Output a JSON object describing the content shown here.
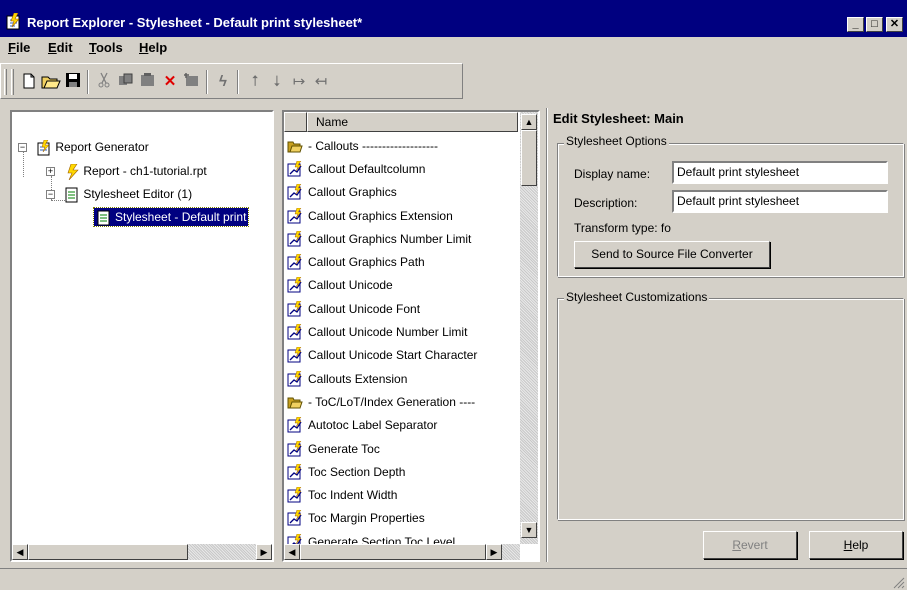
{
  "window": {
    "title": "Report Explorer - Stylesheet - Default print stylesheet*",
    "caption_buttons": [
      "minimize",
      "maximize",
      "close"
    ]
  },
  "menu": [
    {
      "key": "F",
      "rest": "ile"
    },
    {
      "key": "E",
      "rest": "dit"
    },
    {
      "key": "T",
      "rest": "ools"
    },
    {
      "key": "H",
      "rest": "elp"
    }
  ],
  "toolbar": {
    "icons": [
      "new-icon",
      "open-icon",
      "save-icon",
      "cut-icon",
      "copy-icon",
      "paste-icon",
      "delete-icon",
      "paste-special-icon",
      "run-icon",
      "move-up-icon",
      "move-down-icon",
      "demote-icon",
      "promote-icon"
    ]
  },
  "tree": {
    "items": [
      {
        "label": "Report Generator",
        "icon": "report-generator-icon"
      },
      {
        "label": "Report - ch1-tutorial.rpt",
        "icon": "report-icon"
      },
      {
        "label": "Stylesheet Editor (1)",
        "icon": "stylesheet-editor-icon"
      },
      {
        "label": "Stylesheet - Default print",
        "icon": "stylesheet-icon",
        "selected": true
      }
    ]
  },
  "list": {
    "header": "Name",
    "items": [
      {
        "label": "- Callouts -------------------",
        "icon": "folder-open-icon"
      },
      {
        "label": "Callout Defaultcolumn",
        "icon": "property-icon"
      },
      {
        "label": "Callout Graphics",
        "icon": "property-icon"
      },
      {
        "label": "Callout Graphics Extension",
        "icon": "property-icon"
      },
      {
        "label": "Callout Graphics Number Limit",
        "icon": "property-icon"
      },
      {
        "label": "Callout Graphics Path",
        "icon": "property-icon"
      },
      {
        "label": "Callout Unicode",
        "icon": "property-icon"
      },
      {
        "label": "Callout Unicode Font",
        "icon": "property-icon"
      },
      {
        "label": "Callout Unicode Number Limit",
        "icon": "property-icon"
      },
      {
        "label": "Callout Unicode Start Character",
        "icon": "property-icon"
      },
      {
        "label": "Callouts Extension",
        "icon": "property-icon"
      },
      {
        "label": "- ToC/LoT/Index Generation ----",
        "icon": "folder-open-icon"
      },
      {
        "label": "Autotoc Label Separator",
        "icon": "property-icon"
      },
      {
        "label": "Generate Toc",
        "icon": "property-icon"
      },
      {
        "label": "Toc Section Depth",
        "icon": "property-icon"
      },
      {
        "label": "Toc Indent Width",
        "icon": "property-icon"
      },
      {
        "label": "Toc Margin Properties",
        "icon": "property-icon"
      },
      {
        "label": "Generate Section Toc Level",
        "icon": "property-icon"
      }
    ]
  },
  "editor": {
    "heading": "Edit Stylesheet: Main",
    "options_group": "Stylesheet Options",
    "display_name_label": "Display name:",
    "display_name_value": "Default print stylesheet",
    "description_label": "Description:",
    "description_value": "Default print stylesheet",
    "transform_type": "Transform type: fo",
    "send_button": "Send to Source File Converter",
    "customizations_group": "Stylesheet Customizations",
    "revert_key": "R",
    "revert_rest": "evert",
    "help_key": "H",
    "help_rest": "elp"
  },
  "colors": {
    "titlebar": "#000080",
    "selection": "#000080",
    "face": "#d4d0c8"
  }
}
